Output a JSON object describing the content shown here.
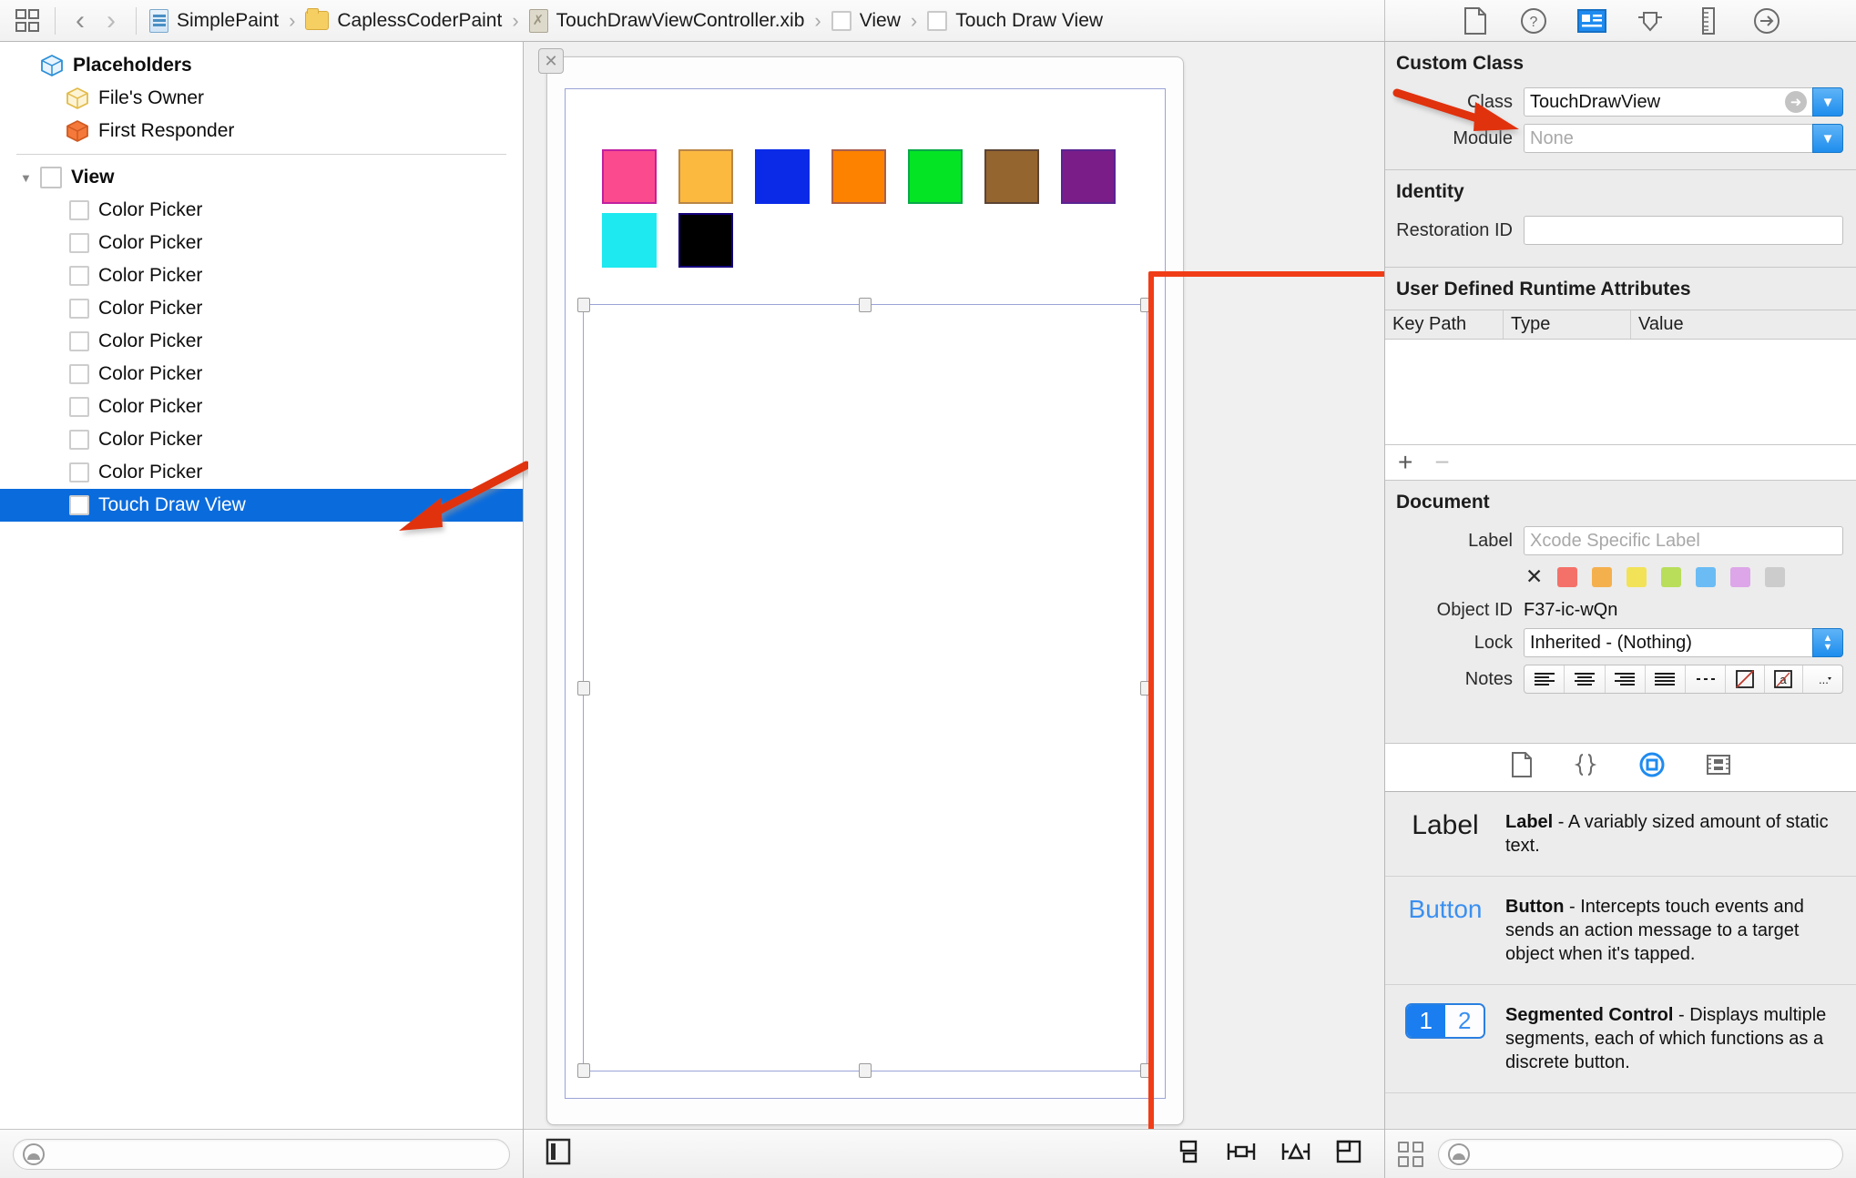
{
  "topbar": {
    "grid_icon": "grid-icon",
    "back_label": "‹",
    "forward_label": "›",
    "breadcrumbs": [
      {
        "label": "SimplePaint",
        "icon": "swift-file-icon"
      },
      {
        "label": "CaplessCoderPaint",
        "icon": "folder-icon"
      },
      {
        "label": "TouchDrawViewController.xib",
        "icon": "xib-file-icon"
      },
      {
        "label": "View",
        "icon": "view-square-icon"
      },
      {
        "label": "Touch Draw View",
        "icon": "view-square-icon"
      }
    ],
    "separator": "›",
    "inspector_buttons": [
      {
        "name": "file-inspector",
        "active": false
      },
      {
        "name": "quick-help-inspector",
        "active": false
      },
      {
        "name": "identity-inspector",
        "active": true
      },
      {
        "name": "attributes-inspector",
        "active": false
      },
      {
        "name": "size-inspector",
        "active": false
      },
      {
        "name": "connections-inspector",
        "active": false
      }
    ]
  },
  "outline": {
    "placeholders_label": "Placeholders",
    "items": [
      {
        "label": "File's Owner",
        "icon": "yellow-cube-icon",
        "indent": 1,
        "selected": false
      },
      {
        "label": "First Responder",
        "icon": "orange-cube-icon",
        "indent": 1,
        "selected": false
      }
    ],
    "view_label": "View",
    "children": [
      {
        "label": "Color Picker",
        "selected": false
      },
      {
        "label": "Color Picker",
        "selected": false
      },
      {
        "label": "Color Picker",
        "selected": false
      },
      {
        "label": "Color Picker",
        "selected": false
      },
      {
        "label": "Color Picker",
        "selected": false
      },
      {
        "label": "Color Picker",
        "selected": false
      },
      {
        "label": "Color Picker",
        "selected": false
      },
      {
        "label": "Color Picker",
        "selected": false
      },
      {
        "label": "Color Picker",
        "selected": false
      },
      {
        "label": "Touch Draw View",
        "selected": true
      }
    ],
    "selection_color": "#0a6bdc",
    "filter_placeholder": "",
    "filter_value": ""
  },
  "canvas": {
    "close_badge": "✕",
    "palette_row1": [
      {
        "name": "pink-swatch",
        "color": "#fb4a8e",
        "border": "#c020a0"
      },
      {
        "name": "orange-swatch",
        "color": "#fcb93f",
        "border": "#b98646"
      },
      {
        "name": "blue-swatch",
        "color": "#0a2ae8",
        "border": "#0a2ae8"
      },
      {
        "name": "darkorange-swatch",
        "color": "#fc8200",
        "border": "#a85f4e"
      },
      {
        "name": "green-swatch",
        "color": "#05e424",
        "border": "#0aa84a"
      },
      {
        "name": "brown-swatch",
        "color": "#94652e",
        "border": "#5c4434"
      },
      {
        "name": "purple-swatch",
        "color": "#7a1d89",
        "border": "#5a2391"
      }
    ],
    "palette_row2": [
      {
        "name": "cyan-swatch",
        "color": "#1ee9f0",
        "border": "#1ee9f0"
      },
      {
        "name": "black-swatch",
        "color": "#000000",
        "border": "#14007a"
      }
    ],
    "selected_view_name": "Touch Draw View",
    "highlight_color": "#f03d17",
    "annotation_arrow_color": "#e0330f"
  },
  "inspector": {
    "custom_class": {
      "title": "Custom Class",
      "class_label": "Class",
      "class_value": "TouchDrawView",
      "module_label": "Module",
      "module_placeholder": "None"
    },
    "identity": {
      "title": "Identity",
      "restoration_label": "Restoration ID",
      "restoration_value": ""
    },
    "runtime_attributes": {
      "title": "User Defined Runtime Attributes",
      "columns": [
        "Key Path",
        "Type",
        "Value"
      ],
      "rows": [],
      "add_label": "+",
      "remove_label": "−"
    },
    "document": {
      "title": "Document",
      "label_label": "Label",
      "label_placeholder": "Xcode Specific Label",
      "swatches": [
        "#f47169",
        "#f5b04e",
        "#f2e257",
        "#b8de5a",
        "#6bbcf5",
        "#dda6e8",
        "#cccccc"
      ],
      "clear_label": "✕",
      "object_id_label": "Object ID",
      "object_id_value": "F37-ic-wQn",
      "lock_label": "Lock",
      "lock_value": "Inherited - (Nothing)",
      "notes_label": "Notes",
      "notes_buttons": [
        "align-left-icon",
        "align-center-icon",
        "align-right-icon",
        "align-justify-icon",
        "dashes-icon",
        "no-color-icon",
        "text-color-icon",
        "more-icon"
      ]
    },
    "pane_tabs": [
      {
        "name": "file-template-library-tab",
        "active": false
      },
      {
        "name": "code-snippet-library-tab",
        "active": false
      },
      {
        "name": "object-library-tab",
        "active": true
      },
      {
        "name": "media-library-tab",
        "active": false
      }
    ],
    "library": [
      {
        "thumb": "Label",
        "thumb_kind": "label",
        "name": "Label",
        "description": " - A variably sized amount of static text."
      },
      {
        "thumb": "Button",
        "thumb_kind": "button",
        "name": "Button",
        "description": " - Intercepts touch events and sends an action message to a target object when it's tapped."
      },
      {
        "thumb": "1 2",
        "thumb_kind": "segmented",
        "thumb_seg1": "1",
        "thumb_seg2": "2",
        "name": "Segmented Control",
        "description": " - Displays multiple segments, each of which functions as a discrete button."
      }
    ],
    "filter_placeholder": "",
    "filter_value": ""
  },
  "bottom_bar": {
    "canvas_left_icon": "show-document-outline-icon",
    "canvas_right_icons": [
      "align-icon",
      "pin-icon",
      "resolve-issues-icon",
      "resizing-behavior-icon"
    ],
    "inspector_grid_icon": "library-grid-icon"
  }
}
